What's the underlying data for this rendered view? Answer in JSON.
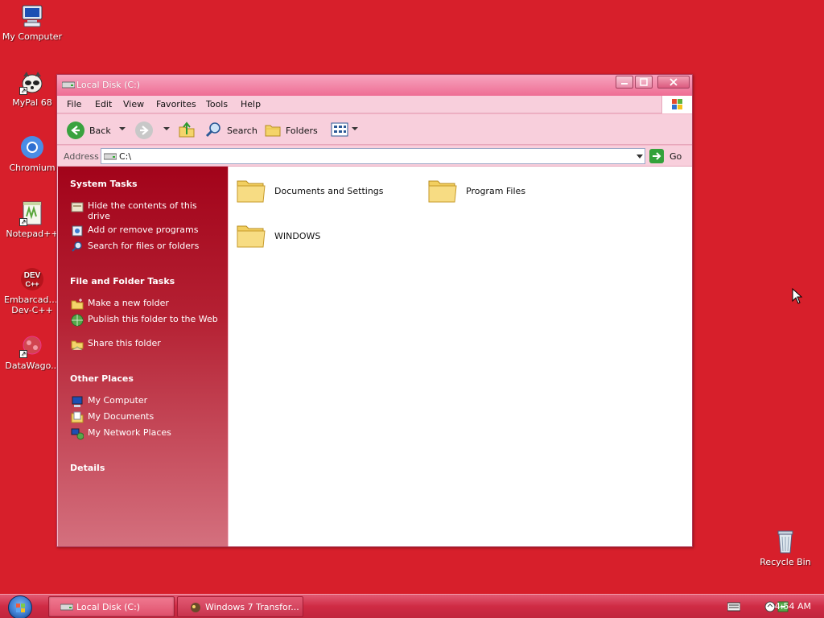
{
  "desktop": {
    "icons": [
      {
        "label": "My Computer"
      },
      {
        "label": "MyPal 68"
      },
      {
        "label": "Chromium"
      },
      {
        "label": "Notepad++"
      },
      {
        "label": "Embarcadero Dev-C++"
      },
      {
        "label": "DataWago..."
      },
      {
        "label": "Recycle Bin"
      }
    ]
  },
  "window": {
    "title": "Local Disk (C:)",
    "menu": [
      "File",
      "Edit",
      "View",
      "Favorites",
      "Tools",
      "Help"
    ],
    "toolbar": {
      "back_label": "Back",
      "search_label": "Search",
      "folders_label": "Folders"
    },
    "address": {
      "label": "Address",
      "value": "C:\\",
      "go_label": "Go"
    },
    "taskpane": {
      "system_tasks": {
        "title": "System Tasks",
        "items": [
          {
            "label": "Hide the contents of this drive"
          },
          {
            "label": "Add or remove programs"
          },
          {
            "label": "Search for files or folders"
          }
        ]
      },
      "file_folder_tasks": {
        "title": "File and Folder Tasks",
        "items": [
          {
            "label": "Make a new folder"
          },
          {
            "label": "Publish this folder to the Web"
          },
          {
            "label": "Share this folder"
          }
        ]
      },
      "other_places": {
        "title": "Other Places",
        "items": [
          {
            "label": "My Computer"
          },
          {
            "label": "My Documents"
          },
          {
            "label": "My Network Places"
          }
        ]
      },
      "details": {
        "title": "Details"
      }
    },
    "folders": [
      {
        "name": "Documents and Settings"
      },
      {
        "name": "Program Files"
      },
      {
        "name": "WINDOWS"
      }
    ]
  },
  "taskbar": {
    "buttons": [
      {
        "label": "Local Disk (C:)",
        "active": true
      },
      {
        "label": "Windows 7 Transfor...",
        "active": false
      }
    ],
    "clock": "4:54 AM"
  },
  "colors": {
    "desktop_bg": "#d71f2b",
    "taskpane_top": "#a2031a",
    "window_chrome": "#f8cfdc",
    "title_gradient_end": "#ee6d93"
  }
}
